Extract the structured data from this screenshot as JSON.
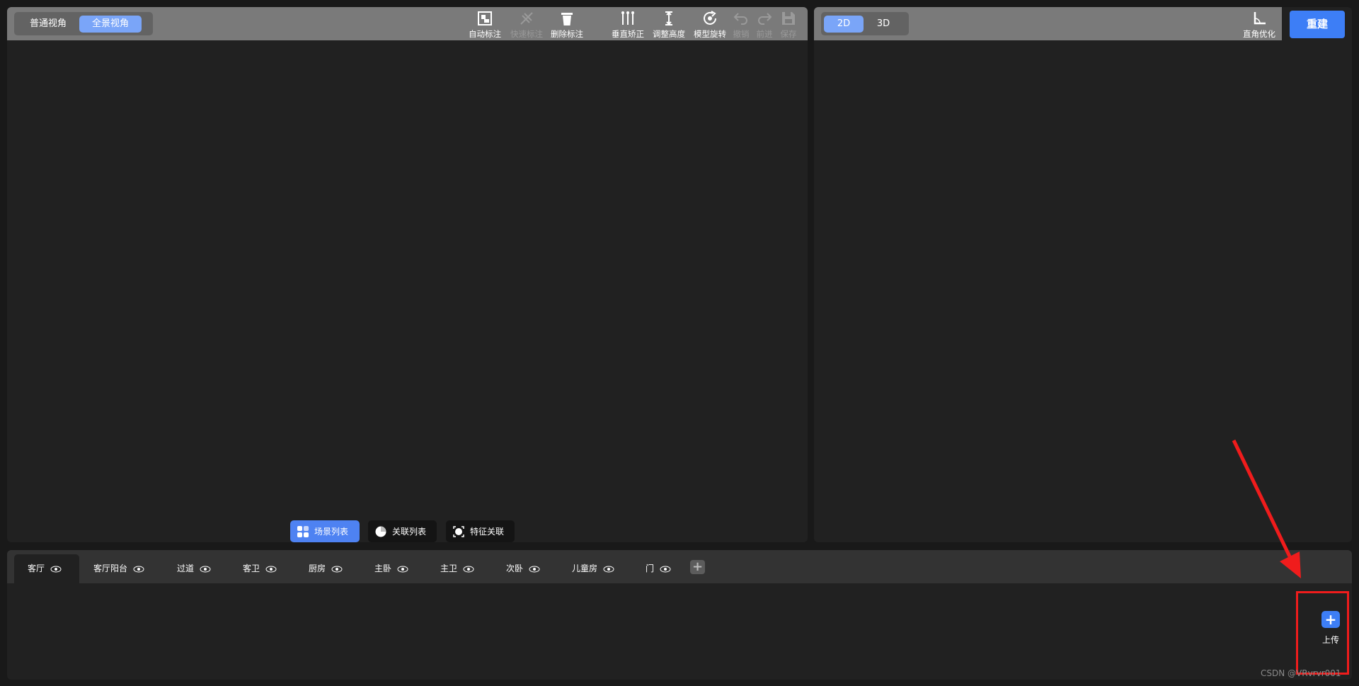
{
  "left_toolbar": {
    "view_modes": [
      "普通视角",
      "全景视角"
    ],
    "active_view": "全景视角",
    "tools": [
      {
        "label": "自动标注",
        "icon": "auto-mark-icon",
        "enabled": true
      },
      {
        "label": "快速标注",
        "icon": "quick-mark-icon",
        "enabled": false
      },
      {
        "label": "删除标注",
        "icon": "trash-icon",
        "enabled": true
      },
      {
        "label": "垂直矫正",
        "icon": "vertical-correct-icon",
        "enabled": true
      },
      {
        "label": "调整高度",
        "icon": "height-adjust-icon",
        "enabled": true
      },
      {
        "label": "模型旋转",
        "icon": "rotate-icon",
        "enabled": true
      },
      {
        "label": "撤销",
        "icon": "undo-icon",
        "enabled": false
      },
      {
        "label": "前进",
        "icon": "redo-icon",
        "enabled": false
      },
      {
        "label": "保存",
        "icon": "save-icon",
        "enabled": false
      }
    ]
  },
  "left_bottom_buttons": [
    {
      "label": "场景列表",
      "icon": "scene-list-icon",
      "active": true
    },
    {
      "label": "关联列表",
      "icon": "link-list-icon",
      "active": false
    },
    {
      "label": "特征关联",
      "icon": "feature-link-icon",
      "active": false
    }
  ],
  "right_toolbar": {
    "dimension_modes": [
      "2D",
      "3D"
    ],
    "active_dimension": "2D",
    "tools": [
      {
        "label": "直角优化",
        "icon": "right-angle-icon",
        "enabled": true
      }
    ]
  },
  "rebuild_label": "重建",
  "room_tabs": [
    {
      "label": "客厅",
      "active": true
    },
    {
      "label": "客厅阳台",
      "active": false
    },
    {
      "label": "过道",
      "active": false
    },
    {
      "label": "客卫",
      "active": false
    },
    {
      "label": "厨房",
      "active": false
    },
    {
      "label": "主卧",
      "active": false
    },
    {
      "label": "主卫",
      "active": false
    },
    {
      "label": "次卧",
      "active": false
    },
    {
      "label": "儿童房",
      "active": false
    },
    {
      "label": "门",
      "active": false
    }
  ],
  "upload": {
    "label": "上传",
    "icon": "plus-icon"
  },
  "annotation": {
    "color": "#f01c1c"
  },
  "watermark": "CSDN @VRvrvr001",
  "colors": {
    "accent": "#3d7ef6",
    "active_tab_seg": "#7aa5f8",
    "toolbar": "#7a7a7a"
  }
}
